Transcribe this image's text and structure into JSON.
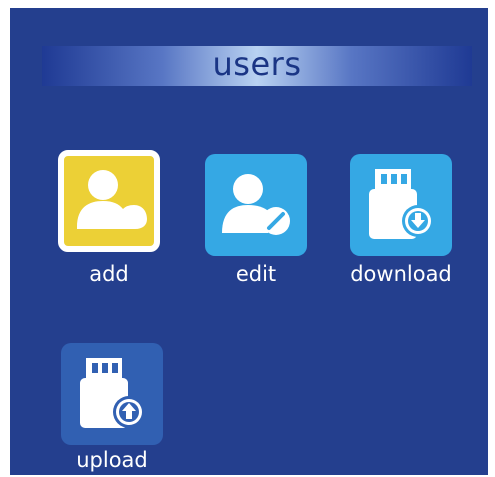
{
  "header": {
    "title": "users"
  },
  "tiles": [
    {
      "label": "add",
      "icon": "add-user-icon"
    },
    {
      "label": "edit",
      "icon": "edit-user-icon"
    },
    {
      "label": "download",
      "icon": "usb-download-icon"
    },
    {
      "label": "upload",
      "icon": "usb-upload-icon"
    }
  ],
  "colors": {
    "background": "#243f8e",
    "selected_tile": "#ecd036",
    "tile": "#35a8e4",
    "upload_tile": "#3160b2",
    "label_text": "#ffffff",
    "title_text": "#1a3585"
  }
}
